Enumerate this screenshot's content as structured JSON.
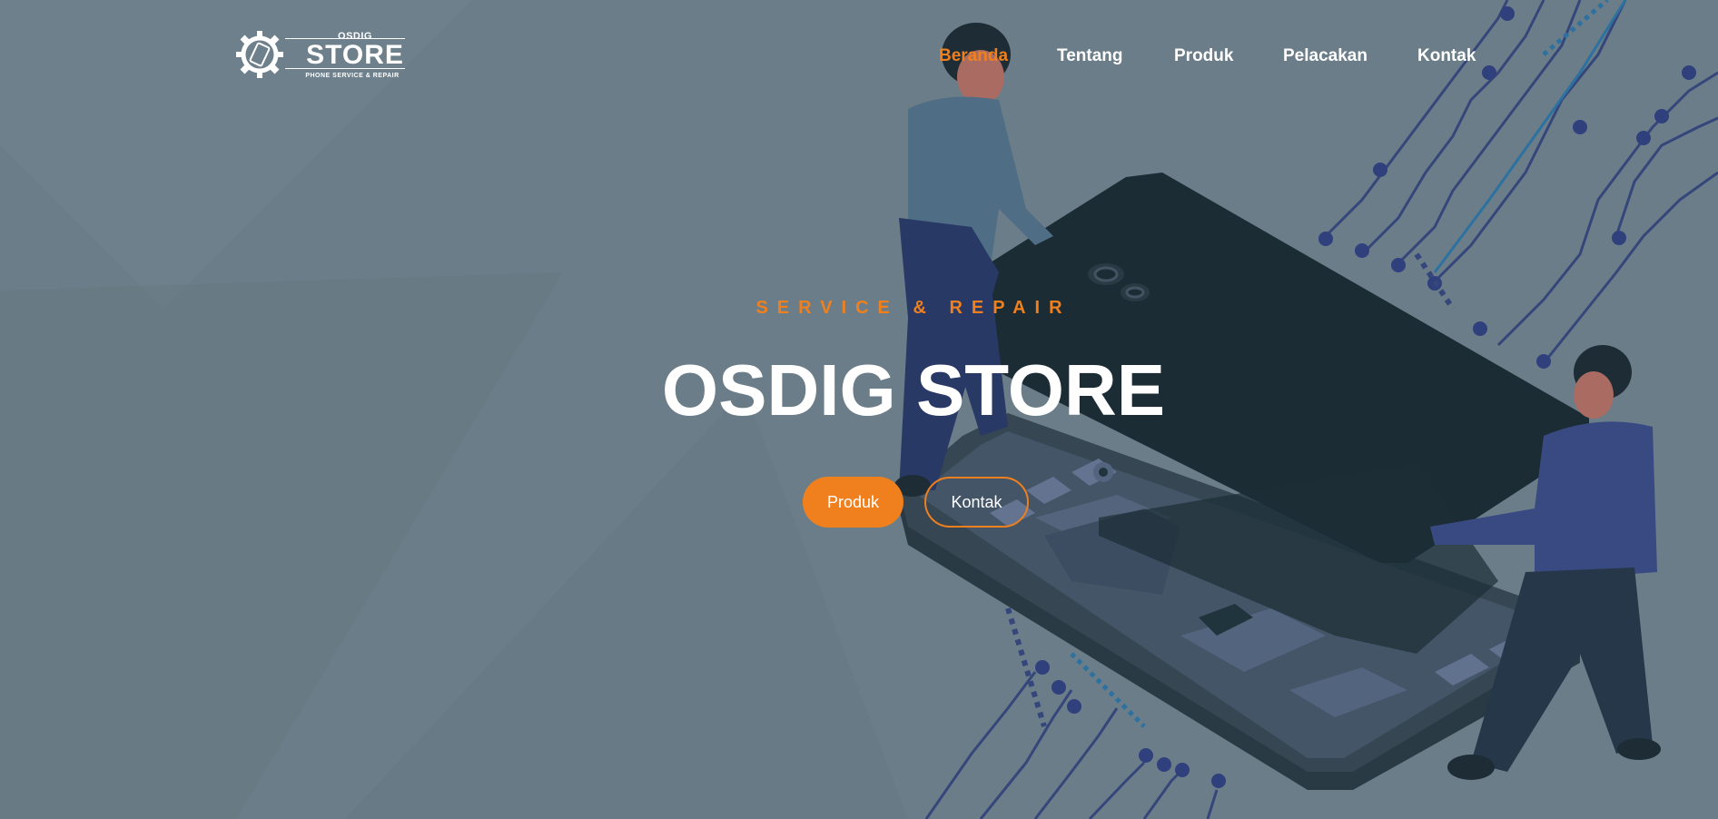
{
  "logo": {
    "small": "OSDIG",
    "main": "STORE",
    "tagline": "PHONE SERVICE & REPAIR"
  },
  "nav": {
    "items": [
      {
        "label": "Beranda",
        "active": true
      },
      {
        "label": "Tentang",
        "active": false
      },
      {
        "label": "Produk",
        "active": false
      },
      {
        "label": "Pelacakan",
        "active": false
      },
      {
        "label": "Kontak",
        "active": false
      }
    ]
  },
  "hero": {
    "eyebrow": "SERVICE & REPAIR",
    "title": "OSDIG STORE",
    "primary_button": "Produk",
    "secondary_button": "Kontak"
  },
  "colors": {
    "accent": "#f0801d",
    "background": "#6b7d88",
    "phone_dark": "#0d1c25",
    "text_light": "#ffffff"
  },
  "icons": {
    "logo_icon": "gear-phone-icon"
  }
}
